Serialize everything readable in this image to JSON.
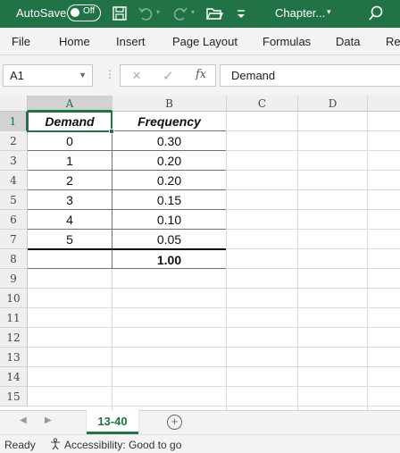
{
  "titlebar": {
    "autosave_label": "AutoSave",
    "toggle_state": "Off",
    "doc_title": "Chapter...",
    "caret": "▾",
    "background": "#217346"
  },
  "ribbon": {
    "tabs": [
      "File",
      "Home",
      "Insert",
      "Page Layout",
      "Formulas",
      "Data",
      "Re"
    ]
  },
  "formula_bar": {
    "name_box": "A1",
    "fx_label": "fx",
    "formula_value": "Demand"
  },
  "grid": {
    "columns": [
      "A",
      "B",
      "C",
      "D"
    ],
    "row_numbers": [
      "1",
      "2",
      "3",
      "4",
      "5",
      "6",
      "7",
      "8",
      "9",
      "10",
      "11",
      "12",
      "13",
      "14",
      "15"
    ],
    "header_row": {
      "a": "Demand",
      "b": "Frequency"
    },
    "data_rows": [
      {
        "a": "0",
        "b": "0.30"
      },
      {
        "a": "1",
        "b": "0.20"
      },
      {
        "a": "2",
        "b": "0.20"
      },
      {
        "a": "3",
        "b": "0.15"
      },
      {
        "a": "4",
        "b": "0.10"
      },
      {
        "a": "5",
        "b": "0.05"
      }
    ],
    "total_row": {
      "a": "",
      "b": "1.00"
    }
  },
  "sheet_tabs": {
    "active": "13-40",
    "add_label": "+"
  },
  "status": {
    "ready": "Ready",
    "accessibility": "Accessibility: Good to go"
  },
  "icons": [
    "save-icon",
    "undo-icon",
    "redo-icon",
    "open-folder-icon",
    "customize-toolbar-icon",
    "search-icon",
    "cancel-icon",
    "enter-icon",
    "insert-function-icon",
    "add-sheet-icon",
    "accessibility-icon"
  ],
  "colors": {
    "accent": "#217346",
    "chrome": "#f3f3f3",
    "header": "#efefef"
  }
}
